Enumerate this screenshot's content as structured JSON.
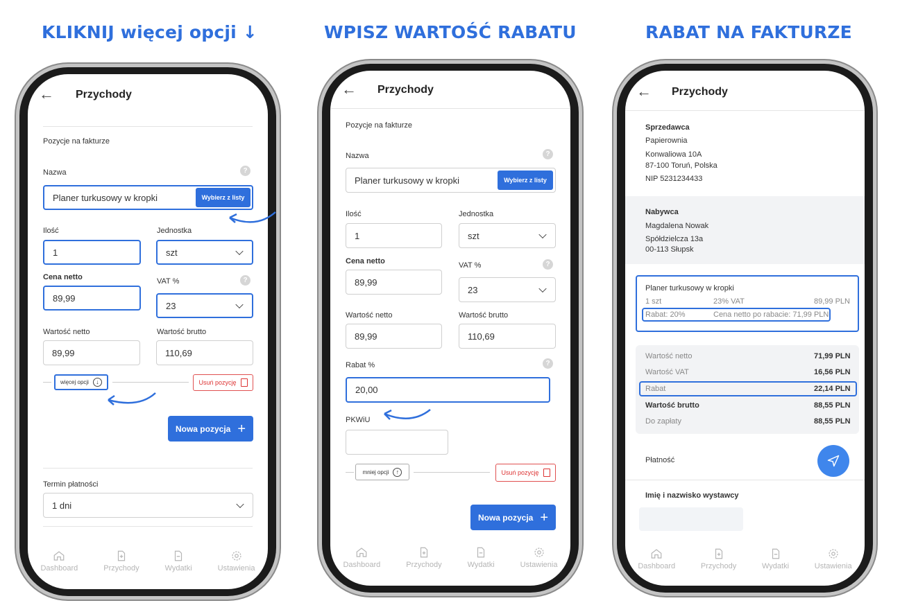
{
  "headings": [
    "KLIKNIJ więcej opcji ↓",
    "WPISZ WARTOŚĆ RABATU",
    "RABAT NA FAKTURZE"
  ],
  "app": {
    "title": "Przychody"
  },
  "tabs": [
    "Dashboard",
    "Przychody",
    "Wydatki",
    "Ustawienia"
  ],
  "form": {
    "section_title": "Pozycje na fakturze",
    "name_label": "Nazwa",
    "name_value": "Planer turkusowy w kropki",
    "pick_button": "Wybierz z listy",
    "qty_label": "Ilość",
    "qty_value": "1",
    "unit_label": "Jednostka",
    "unit_value": "szt",
    "net_price_label": "Cena netto",
    "net_price_value": "89,99",
    "vat_label": "VAT %",
    "vat_value": "23",
    "net_value_label": "Wartość netto",
    "net_value_value": "89,99",
    "gross_value_label": "Wartość brutto",
    "gross_value_value": "110,69",
    "more_options": "więcej opcji",
    "less_options": "mniej opcji",
    "remove_item": "Usuń pozycję",
    "new_item": "Nowa pozycja",
    "payment_term_label": "Termin płatności",
    "payment_term_value": "1 dni",
    "discount_label": "Rabat %",
    "discount_value": "20,00",
    "pkwiu_label": "PKWiU",
    "pkwiu_value": ""
  },
  "invoice": {
    "seller_label": "Sprzedawca",
    "seller_name": "Papierownia",
    "seller_street": "Konwaliowa 10A",
    "seller_city": "87-100 Toruń, Polska",
    "seller_nip": "NIP 5231234433",
    "buyer_label": "Nabywca",
    "buyer_name": "Magdalena Nowak",
    "buyer_street": "Spółdzielcza 13a",
    "buyer_city": "00-113 Słupsk",
    "item_name": "Planer turkusowy w kropki",
    "item_qty": "1 szt",
    "item_vat": "23% VAT",
    "item_price": "89,99 PLN",
    "item_discount": "Rabat: 20%",
    "item_discount_price": "Cena netto po rabacie: 71,99 PLN",
    "summary": [
      {
        "label": "Wartość netto",
        "value": "71,99 PLN"
      },
      {
        "label": "Wartość VAT",
        "value": "16,56 PLN"
      },
      {
        "label": "Rabat",
        "value": "22,14 PLN"
      },
      {
        "label": "Wartość brutto",
        "value": "88,55 PLN"
      },
      {
        "label": "Do zapłaty",
        "value": "88,55 PLN"
      }
    ],
    "payment_label": "Płatność",
    "issuer_label": "Imię i nazwisko wystawcy"
  }
}
